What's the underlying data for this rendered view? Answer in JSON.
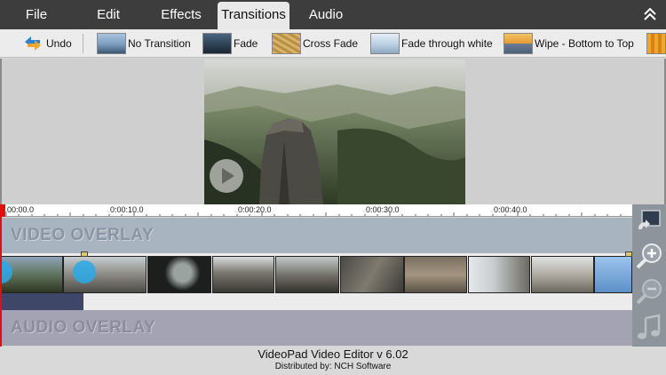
{
  "menu": {
    "items": [
      {
        "label": "File",
        "active": false
      },
      {
        "label": "Edit",
        "active": false
      },
      {
        "label": "Effects",
        "active": false
      },
      {
        "label": "Transitions",
        "active": true
      },
      {
        "label": "Audio",
        "active": false
      }
    ],
    "collapse_icon": "double-chevron-up-icon"
  },
  "toolbar": {
    "undo_label": "Undo",
    "undo_icon": "undo-arrows-icon",
    "transitions": [
      {
        "label": "No Transition",
        "thumb": "#6f8fb3"
      },
      {
        "label": "Fade",
        "thumb": "#2e4256"
      },
      {
        "label": "Cross Fade",
        "thumb": "#c9a25a"
      },
      {
        "label": "Fade through white",
        "thumb": "#b8cde0"
      },
      {
        "label": "Wipe - Bottom to Top",
        "thumb": "#e7a844"
      },
      {
        "label": "",
        "thumb": "#e89a2a"
      }
    ]
  },
  "preview": {
    "play_icon": "play-icon"
  },
  "ruler": {
    "ticks": [
      "00:00.0",
      "0:00:10.0",
      "0:00:20.0",
      "0:00:30.0",
      "0:00:40.0"
    ]
  },
  "tracks": {
    "video_overlay_label": "VIDEO OVERLAY",
    "audio_overlay_label": "AUDIO OVERLAY"
  },
  "sidepanel": {
    "icons": [
      "add-to-track-icon",
      "zoom-in-icon",
      "zoom-out-icon",
      "music-note-icon"
    ]
  },
  "status": {
    "title": "VideoPad Video Editor v 6.02",
    "subtitle": "Distributed by: NCH Software"
  },
  "colors": {
    "menubar": "#3d3d3d",
    "playhead": "#e01010",
    "transition_dot": "#2aa9e8"
  }
}
